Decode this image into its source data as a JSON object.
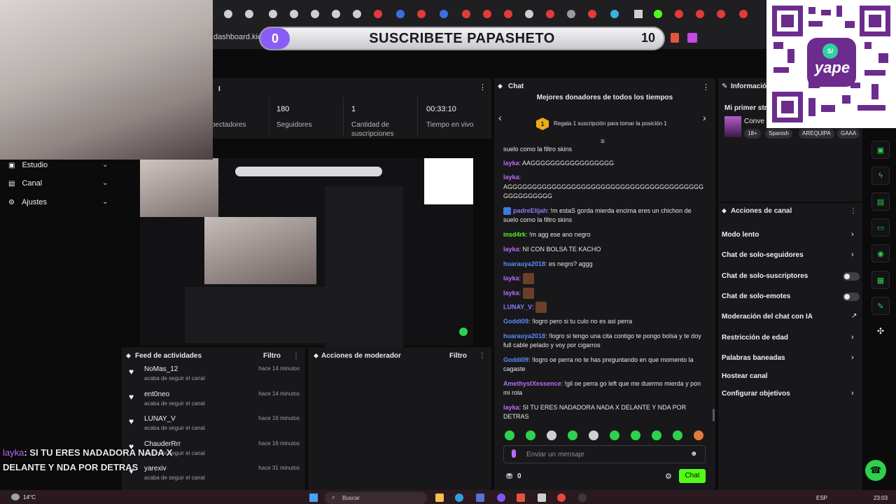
{
  "browser": {
    "url": "dashboard.kick."
  },
  "stream_overlay": {
    "banner_left_value": "0",
    "banner_text": "SUSCRIBETE PAPASHETO",
    "banner_right_value": "10",
    "overlay_chat_user": "layka",
    "overlay_chat_text": ": SI TU ERES NADADORA NADA X DELANTE Y NDA POR DETRAS",
    "qr_brand": "yape",
    "qr_brand_prefix": "S/"
  },
  "stats": [
    {
      "value": "",
      "label": "pectadores"
    },
    {
      "value": "180",
      "label": "Seguidores"
    },
    {
      "value": "1",
      "label": "Cantidad de suscripciones"
    },
    {
      "value": "00:33:10",
      "label": "Tiempo en vivo"
    }
  ],
  "sidebar": {
    "items": [
      {
        "label": "Estudio",
        "icon": "studio-icon"
      },
      {
        "label": "Canal",
        "icon": "channel-icon"
      },
      {
        "label": "Ajustes",
        "icon": "gear-icon"
      }
    ]
  },
  "activity_feed": {
    "title": "Feed de actividades",
    "filter": "Filtro",
    "items": [
      {
        "name": "NoMas_12",
        "sub": "acaba de seguir el canal",
        "time": "hace 14 minutos"
      },
      {
        "name": "ent0neo",
        "sub": "acaba de seguir el canal",
        "time": "hace 14 minutos"
      },
      {
        "name": "LUNAY_V",
        "sub": "acaba de seguir el canal",
        "time": "hace 16 minutos"
      },
      {
        "name": "ChauderRrr",
        "sub": "acaba de seguir el canal",
        "time": "hace 16 minutos"
      },
      {
        "name": "yarexiv",
        "sub": "acaba de seguir el canal",
        "time": "hace 31 minutos"
      }
    ]
  },
  "mod_actions": {
    "title": "Acciones de moderador",
    "filter": "Filtro"
  },
  "chat": {
    "title": "Chat",
    "donors_title": "Mejores donadores de todos los tiempos",
    "donors_rank": "1",
    "donors_cta": "Regala 1 suscripción para tomar la posición 1",
    "messages": [
      {
        "user": "",
        "text": "suelo como la filtro skins",
        "color": "#e8e8ea"
      },
      {
        "user": "layka",
        "text": ": AAGGGGGGGGGGGGGGGGG",
        "color": "#b66ef7"
      },
      {
        "user": "layka",
        "text": ":",
        "color": "#b66ef7"
      },
      {
        "user": "",
        "text": "AGGGGGGGGGGGGGGGGGGGGGGGGGGGGGGGGGGGGGGGGGGGGGGGGGG",
        "color": "#e8e8ea"
      },
      {
        "user": "padreElijah",
        "text": ": !m estaS gorda mierda encima eres un chichon de suelo como la filtro skins",
        "color": "#8a7cf6"
      },
      {
        "user": "insd4rk",
        "text": ": !m agg ese ano negro",
        "color": "#53fc18"
      },
      {
        "user": "layka",
        "text": ": NI CON BOLSA TE KACHO",
        "color": "#b66ef7"
      },
      {
        "user": "huarauya2018",
        "text": ": es negro? aggg",
        "color": "#5b8cf5"
      },
      {
        "user": "layka",
        "text": ":",
        "color": "#b66ef7"
      },
      {
        "user": "layka",
        "text": ":",
        "color": "#b66ef7"
      },
      {
        "user": "LUNAY_V",
        "text": ":",
        "color": "#8a7cf6"
      },
      {
        "user": "Goddi09",
        "text": ": !logro pero si tu culo no es asi perra",
        "color": "#5b8cf5"
      },
      {
        "user": "huarauya2018",
        "text": ": !logro si tengo una cita contigo te pongo bolsa y te doy full cable pelado y voy por cigarros",
        "color": "#5b8cf5"
      },
      {
        "user": "Goddi09",
        "text": ": !logro oe perra no te has preguntando en que momento la cagaste",
        "color": "#5b8cf5"
      },
      {
        "user": "AmethystXessence",
        "text": ": !gil oe perra go left que me duermo mierda y pon mi rola",
        "color": "#b66ef7"
      },
      {
        "user": "layka",
        "text": ": SI TU ERES NADADORA NADA X DELANTE Y NDA POR DETRAS",
        "color": "#b66ef7"
      }
    ],
    "input_placeholder": "Enviar un mensaje",
    "points": "0",
    "send_label": "Chat"
  },
  "stream_info": {
    "title": "Informació",
    "stream_title": "Mi primer str",
    "category": "Conve",
    "tags": [
      "18+",
      "Spanish",
      "AREQUIPA",
      "GAAA"
    ]
  },
  "channel_actions": {
    "title": "Acciones de canal",
    "items": [
      {
        "label": "Modo lento",
        "control": "chevron"
      },
      {
        "label": "Chat de solo-seguidores",
        "control": "chevron"
      },
      {
        "label": "Chat de solo-suscriptores",
        "control": "toggle"
      },
      {
        "label": "Chat de solo-emotes",
        "control": "toggle"
      },
      {
        "label": "Moderación del chat con IA",
        "control": "external"
      },
      {
        "label": "Restricción de edad",
        "control": "chevron"
      },
      {
        "label": "Palabras baneadas",
        "control": "chevron"
      },
      {
        "label": "Hostear canal",
        "control": "none"
      },
      {
        "label": "Configurar objetivos",
        "control": "chevron"
      }
    ]
  },
  "taskbar": {
    "weather": "14°C",
    "search": "Buscar",
    "lang": "ESP",
    "time": "23:03"
  },
  "colors": {
    "accent": "#53fc18",
    "panel": "#18181b",
    "background": "#0b0b0c"
  }
}
